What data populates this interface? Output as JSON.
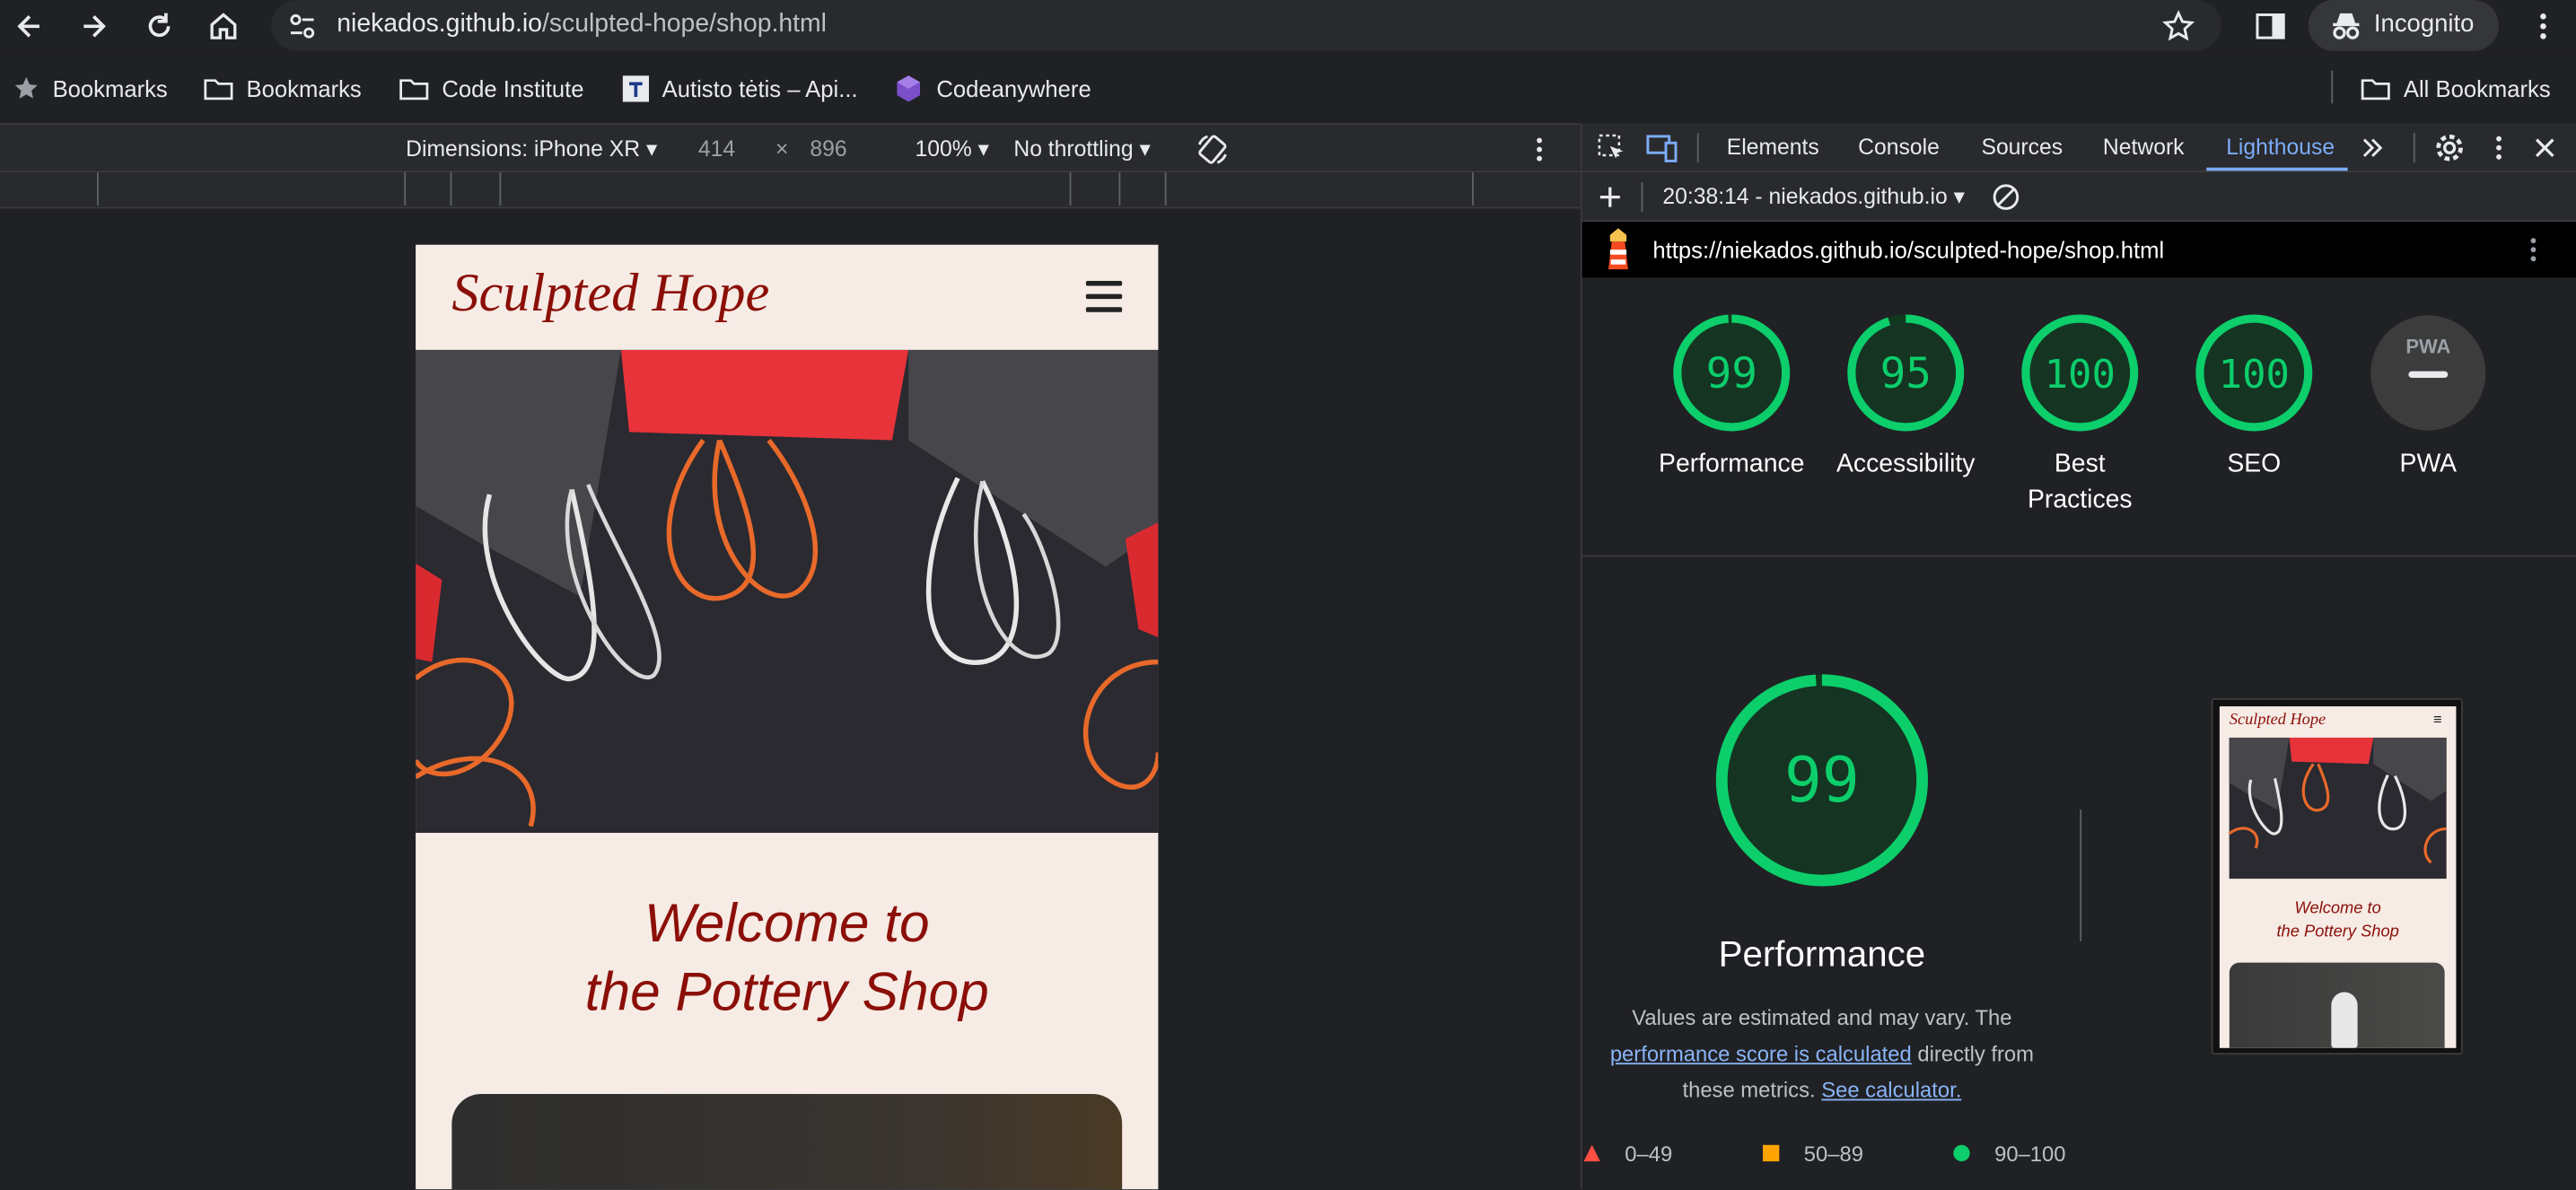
{
  "browser": {
    "url_domain": "niekados.github.io",
    "url_path": "/sculpted-hope/shop.html",
    "incognito_label": "Incognito"
  },
  "bookmarks": {
    "items": [
      {
        "label": "Bookmarks"
      },
      {
        "label": "Bookmarks"
      },
      {
        "label": "Code Institute"
      },
      {
        "label": "Autisto tėtis – Api..."
      },
      {
        "label": "Codeanywhere"
      }
    ],
    "all_label": "All Bookmarks"
  },
  "device_toolbar": {
    "dimensions_label": "Dimensions: iPhone XR",
    "width": "414",
    "times": "×",
    "height": "896",
    "zoom": "100%",
    "throttle": "No throttling"
  },
  "page": {
    "brand": "Sculpted Hope",
    "welcome_line1": "Welcome to",
    "welcome_line2": "the Pottery Shop"
  },
  "devtools": {
    "tabs": [
      {
        "label": "Elements"
      },
      {
        "label": "Console"
      },
      {
        "label": "Sources"
      },
      {
        "label": "Network"
      },
      {
        "label": "Lighthouse"
      }
    ],
    "report_select": "20:38:14 - niekados.github.io",
    "report_url": "https://niekados.github.io/sculpted-hope/shop.html",
    "scores": [
      {
        "label": "Performance",
        "value": "99",
        "fraction": 0.99
      },
      {
        "label": "Accessibility",
        "value": "95",
        "fraction": 0.95
      },
      {
        "label": "Best Practices",
        "label_line1": "Best",
        "label_line2": "Practices",
        "value": "100",
        "fraction": 1.0
      },
      {
        "label": "SEO",
        "value": "100",
        "fraction": 1.0
      },
      {
        "label": "PWA",
        "value": "",
        "badge": "PWA"
      }
    ],
    "performance": {
      "score": "99",
      "fraction": 0.99,
      "title": "Performance",
      "desc_prefix": "Values are estimated and may vary. The",
      "desc_link": "performance score is calculated",
      "desc_mid": "directly from",
      "desc_suffix": "these metrics.",
      "calc_link": "See calculator."
    },
    "legend": [
      {
        "label": "0–49",
        "color": "#ff4e42"
      },
      {
        "label": "50–89",
        "color": "#ffa400"
      },
      {
        "label": "90–100",
        "color": "#0cce6b"
      }
    ]
  },
  "colors": {
    "pass": "#0cce6b",
    "brand_red": "#8b0f08",
    "link": "#8ab4f8"
  }
}
